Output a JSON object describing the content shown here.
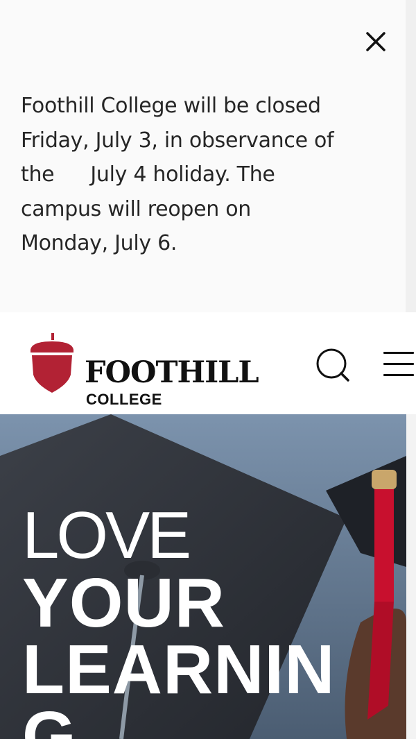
{
  "alert": {
    "line1": "Foothill College will be closed",
    "line2": "Friday, July 3, in observance of",
    "line3a": "the",
    "line3b": "July 4 holiday. The",
    "line4": "campus will reopen on",
    "line5": "Monday, July 6.",
    "close_icon": "close-icon"
  },
  "header": {
    "logo_word": "FOOTHILL",
    "logo_sub": "COLLEGE",
    "logo_icon": "acorn-logo-icon",
    "search_icon": "search-icon",
    "menu_icon": "hamburger-menu-icon"
  },
  "hero": {
    "line1": "LOVE",
    "line2": "YOUR",
    "line3": "LEARNIN",
    "line4": "G"
  },
  "colors": {
    "brand_red": "#b22234",
    "alert_bg": "#fafafa",
    "text": "#262626"
  }
}
